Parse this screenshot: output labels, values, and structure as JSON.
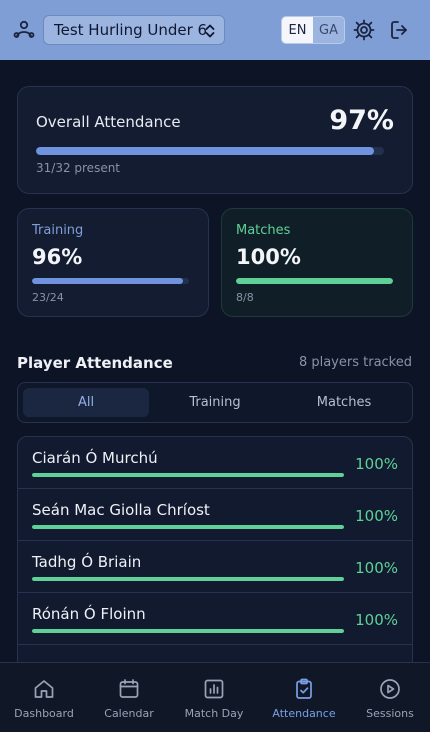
{
  "header": {
    "team_name": "Test Hurling Under 6",
    "lang_active": "EN",
    "lang_inactive": "GA"
  },
  "overall": {
    "label": "Overall Attendance",
    "percent": "97%",
    "fraction": 0.97,
    "sub": "31/32 present"
  },
  "training": {
    "label": "Training",
    "percent": "96%",
    "fraction": 0.96,
    "sub": "23/24"
  },
  "matches": {
    "label": "Matches",
    "percent": "100%",
    "fraction": 1.0,
    "sub": "8/8"
  },
  "players": {
    "title": "Player Attendance",
    "count": "8 players tracked",
    "tabs": [
      "All",
      "Training",
      "Matches"
    ],
    "active_tab": 0,
    "rows": [
      {
        "name": "Ciarán Ó Murchú",
        "percent": "100%",
        "fraction": 1.0
      },
      {
        "name": "Seán Mac Giolla Chríost",
        "percent": "100%",
        "fraction": 1.0
      },
      {
        "name": "Tadhg Ó Briain",
        "percent": "100%",
        "fraction": 1.0
      },
      {
        "name": "Rónán Ó Floinn",
        "percent": "100%",
        "fraction": 1.0
      }
    ]
  },
  "nav": {
    "items": [
      "Dashboard",
      "Calendar",
      "Match Day",
      "Attendance",
      "Sessions"
    ],
    "active": 3
  },
  "colors": {
    "accent_blue": "#6f93de",
    "accent_green": "#5fd197",
    "header_bg": "#7f9ed6"
  }
}
